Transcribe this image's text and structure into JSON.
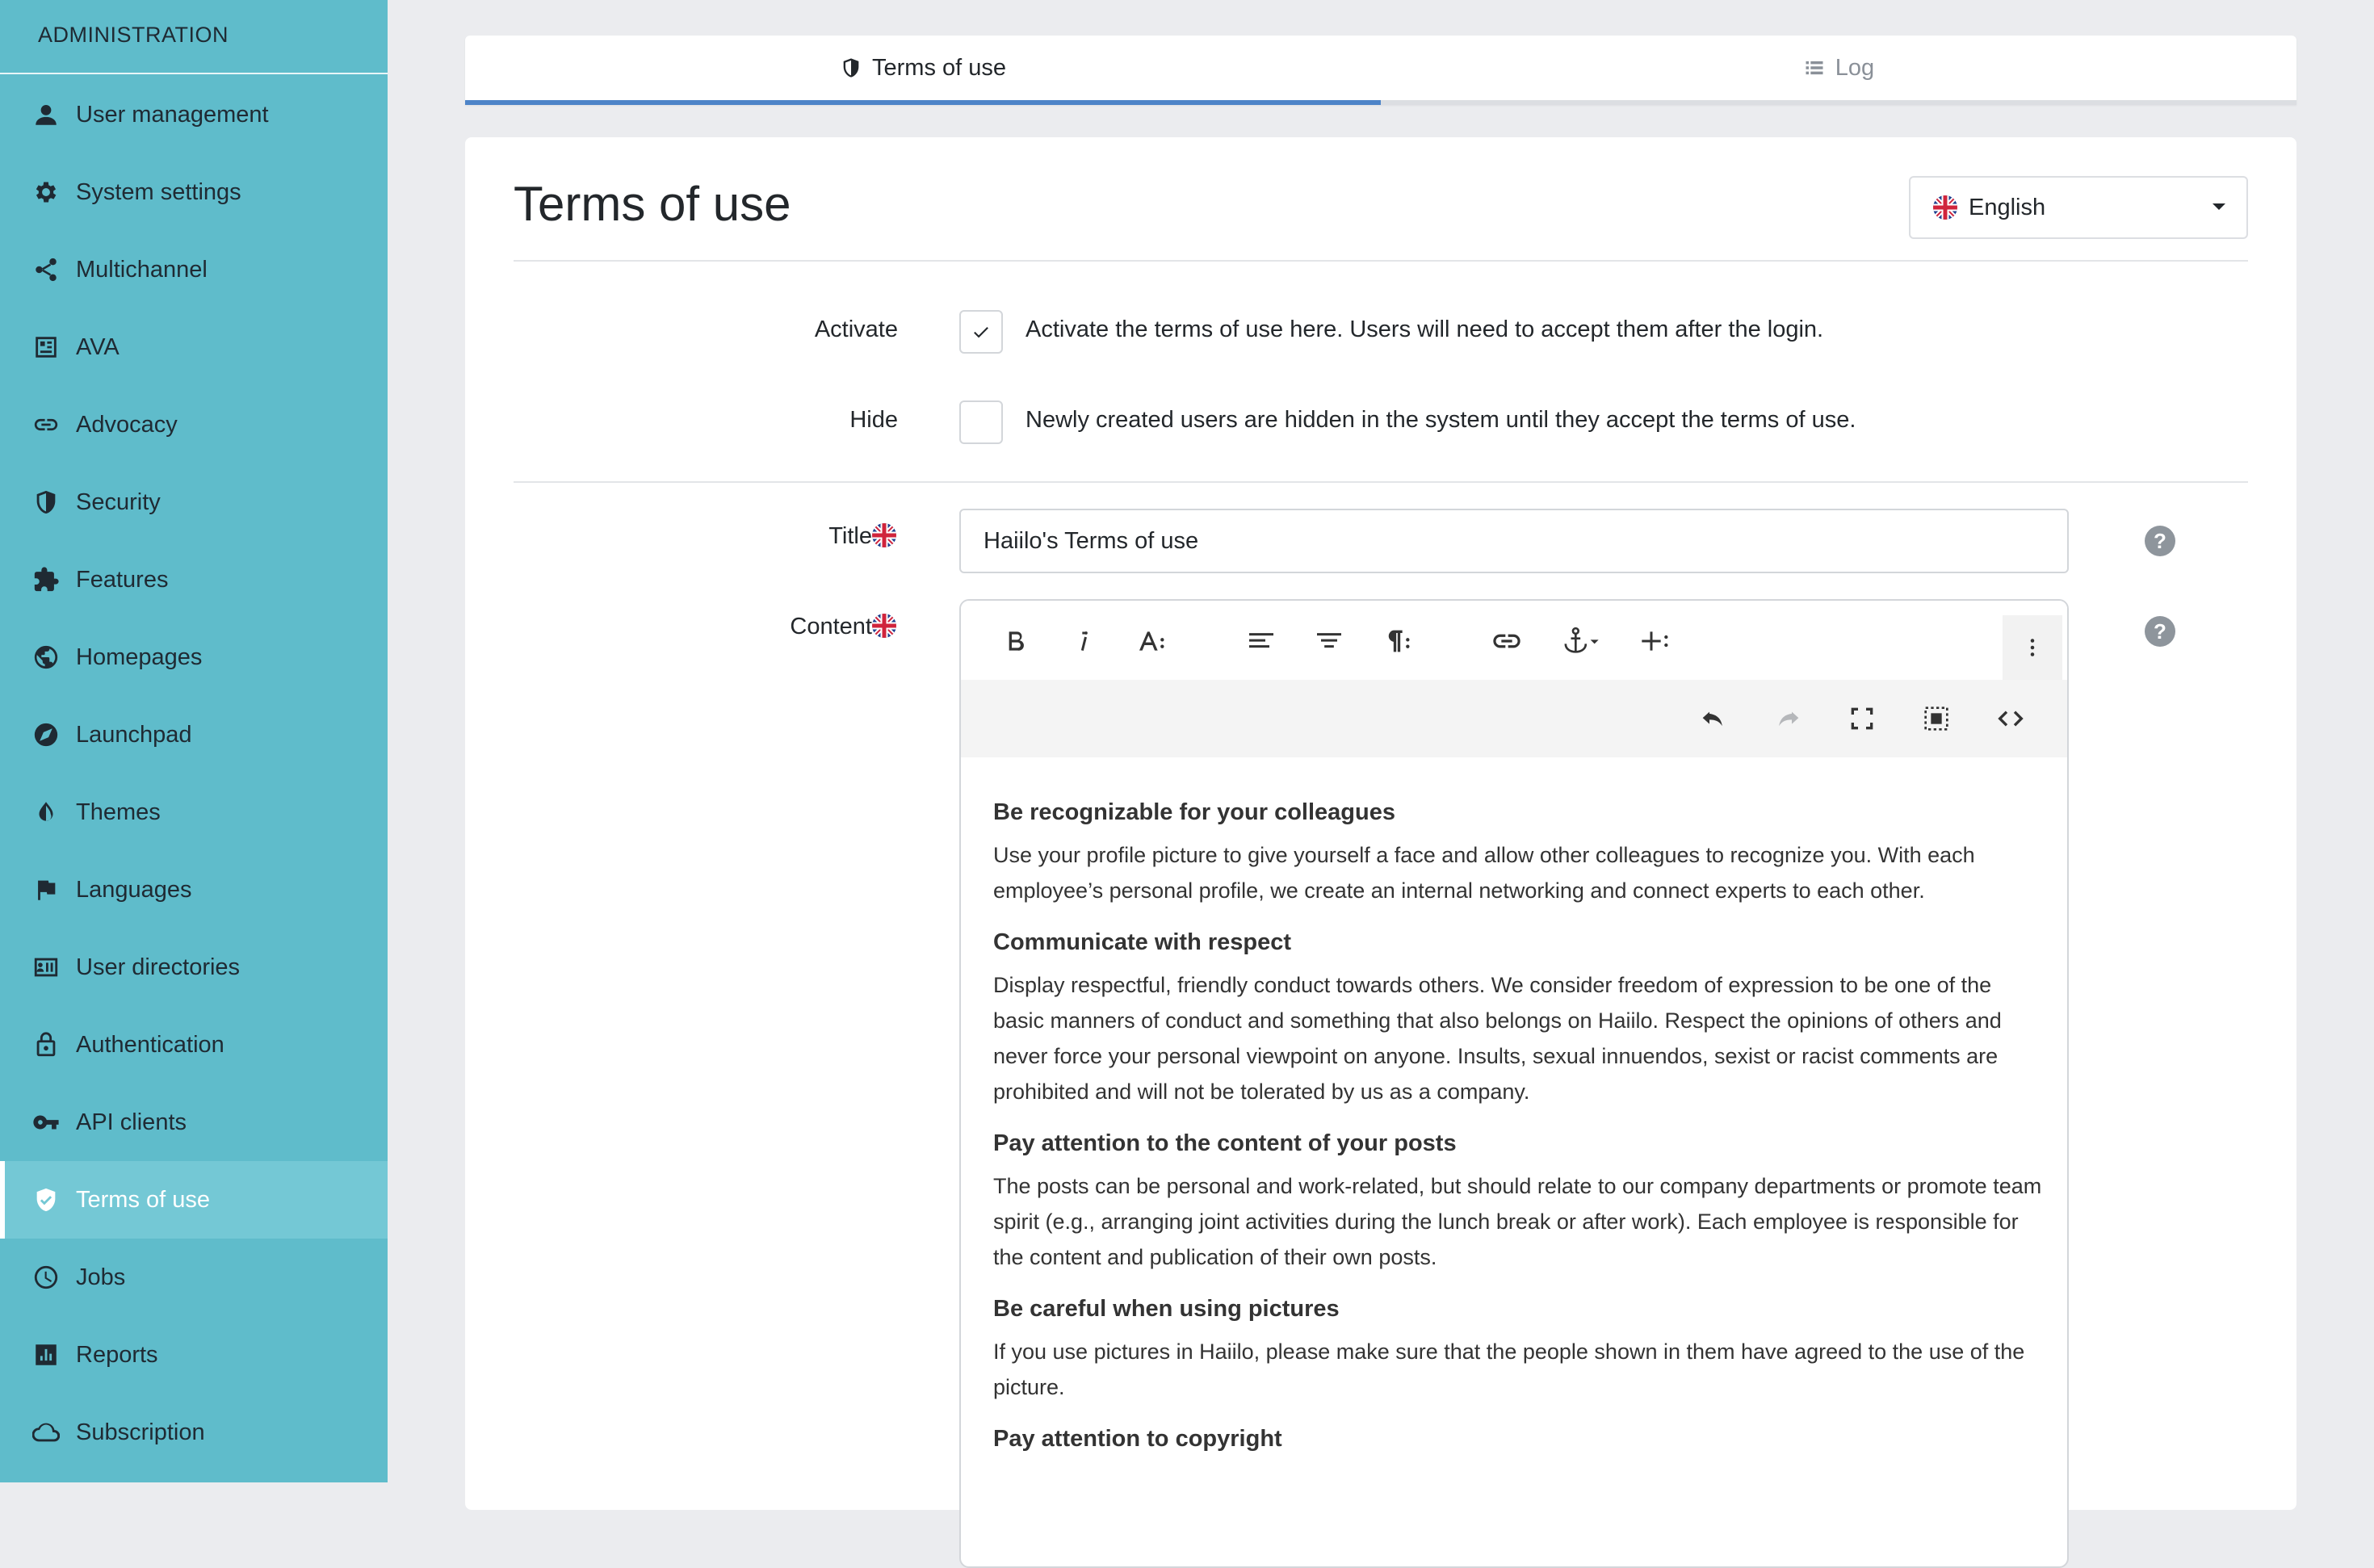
{
  "sidebar": {
    "header": "ADMINISTRATION",
    "items": [
      {
        "label": "User management",
        "icon": "user-icon"
      },
      {
        "label": "System settings",
        "icon": "gear-icon"
      },
      {
        "label": "Multichannel",
        "icon": "share-icon"
      },
      {
        "label": "AVA",
        "icon": "ava-icon"
      },
      {
        "label": "Advocacy",
        "icon": "link-icon"
      },
      {
        "label": "Security",
        "icon": "shield-icon"
      },
      {
        "label": "Features",
        "icon": "puzzle-icon"
      },
      {
        "label": "Homepages",
        "icon": "globe-icon"
      },
      {
        "label": "Launchpad",
        "icon": "compass-icon"
      },
      {
        "label": "Themes",
        "icon": "contrast-icon"
      },
      {
        "label": "Languages",
        "icon": "flag-icon"
      },
      {
        "label": "User directories",
        "icon": "id-card-icon"
      },
      {
        "label": "Authentication",
        "icon": "lock-icon"
      },
      {
        "label": "API clients",
        "icon": "key-icon"
      },
      {
        "label": "Terms of use",
        "icon": "shield-check-icon",
        "active": true
      },
      {
        "label": "Jobs",
        "icon": "clock-icon"
      },
      {
        "label": "Reports",
        "icon": "bar-chart-icon"
      },
      {
        "label": "Subscription",
        "icon": "cloud-icon"
      }
    ]
  },
  "tabs": [
    {
      "label": "Terms of use",
      "icon": "shield-icon",
      "active": true
    },
    {
      "label": "Log",
      "icon": "list-icon",
      "active": false
    }
  ],
  "page": {
    "title": "Terms of use",
    "language": {
      "selected": "English",
      "flag": "uk-flag-icon"
    }
  },
  "form": {
    "activate": {
      "label": "Activate",
      "checked": true,
      "text": "Activate the terms of use here. Users will need to accept them after the login."
    },
    "hide": {
      "label": "Hide",
      "checked": false,
      "text": "Newly created users are hidden in the system until they accept the terms of use."
    },
    "title": {
      "label": "Title",
      "value": "Haiilo's Terms of use"
    },
    "content": {
      "label": "Content"
    }
  },
  "editor": {
    "toolbar_row1": [
      "bold",
      "italic",
      "font-size",
      "align-left",
      "align-center",
      "paragraph-format",
      "insert-link",
      "anchor",
      "insert-more",
      "more-options"
    ],
    "toolbar_row2": [
      "undo",
      "redo",
      "fullscreen",
      "select-all",
      "code-view"
    ],
    "sections": [
      {
        "heading": "Be recognizable for your colleagues",
        "text": "Use your profile picture to give yourself a face and allow other colleagues to recognize you. With each employee’s personal profile, we create an internal networking and connect experts to each other."
      },
      {
        "heading": "Communicate with respect",
        "text": "Display respectful, friendly conduct towards others. We consider freedom of expression to be one of the basic manners of conduct and something that also belongs on Haiilo. Respect the opinions of others and never force your personal viewpoint on anyone. Insults, sexual innuendos, sexist or racist comments are prohibited and will not be tolerated by us as a company."
      },
      {
        "heading": "Pay attention to the content of your posts",
        "text": "The posts can be personal and work-related, but should relate to our company departments or promote team spirit (e.g., arranging joint activities during the lunch break or after work). Each employee is responsible for the content and publication of their own posts."
      },
      {
        "heading": "Be careful when using pictures",
        "text": "If you use pictures in Haiilo, please make sure that the people shown in them have agreed to the use of the picture."
      },
      {
        "heading": "Pay attention to copyright",
        "text": ""
      }
    ]
  },
  "colors": {
    "sidebar": "#5fbccb",
    "sidebar_active": "#74c8d5",
    "tab_accent": "#4d84c8",
    "background": "#ebecef"
  }
}
